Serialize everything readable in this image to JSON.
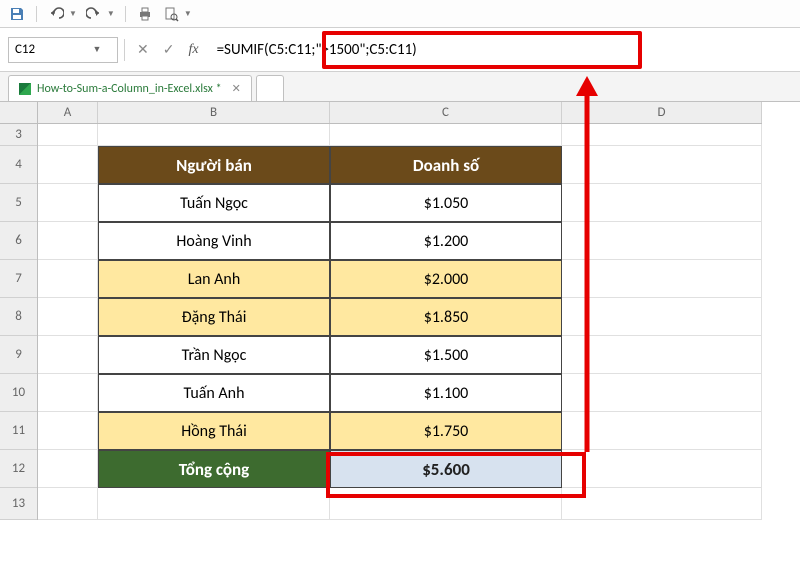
{
  "qat": {
    "icons": [
      "save",
      "undo",
      "redo",
      "print",
      "print-preview"
    ]
  },
  "formula_bar": {
    "name_box": "C12",
    "formula": "=SUMIF(C5:C11;\">1500\";C5:C11)"
  },
  "tabs": [
    {
      "label": "How-to-Sum-a-Column_in-Excel.xlsx *",
      "active": true
    }
  ],
  "columns": [
    "A",
    "B",
    "C",
    "D"
  ],
  "row_numbers": [
    3,
    4,
    5,
    6,
    7,
    8,
    9,
    10,
    11,
    12,
    13
  ],
  "table": {
    "header": {
      "b": "Người bán",
      "c": "Doanh số"
    },
    "rows": [
      {
        "b": "Tuấn Ngọc",
        "c": "$1.050",
        "hl": false
      },
      {
        "b": "Hoàng Vinh",
        "c": "$1.200",
        "hl": false
      },
      {
        "b": "Lan Anh",
        "c": "$2.000",
        "hl": true
      },
      {
        "b": "Đặng Thái",
        "c": "$1.850",
        "hl": true
      },
      {
        "b": "Trần Ngọc",
        "c": "$1.500",
        "hl": false
      },
      {
        "b": "Tuấn Anh",
        "c": "$1.100",
        "hl": false
      },
      {
        "b": "Hồng Thái",
        "c": "$1.750",
        "hl": true
      }
    ],
    "total": {
      "b": "Tổng cộng",
      "c": "$5.600"
    }
  },
  "annotation": {
    "color": "#e60000"
  }
}
